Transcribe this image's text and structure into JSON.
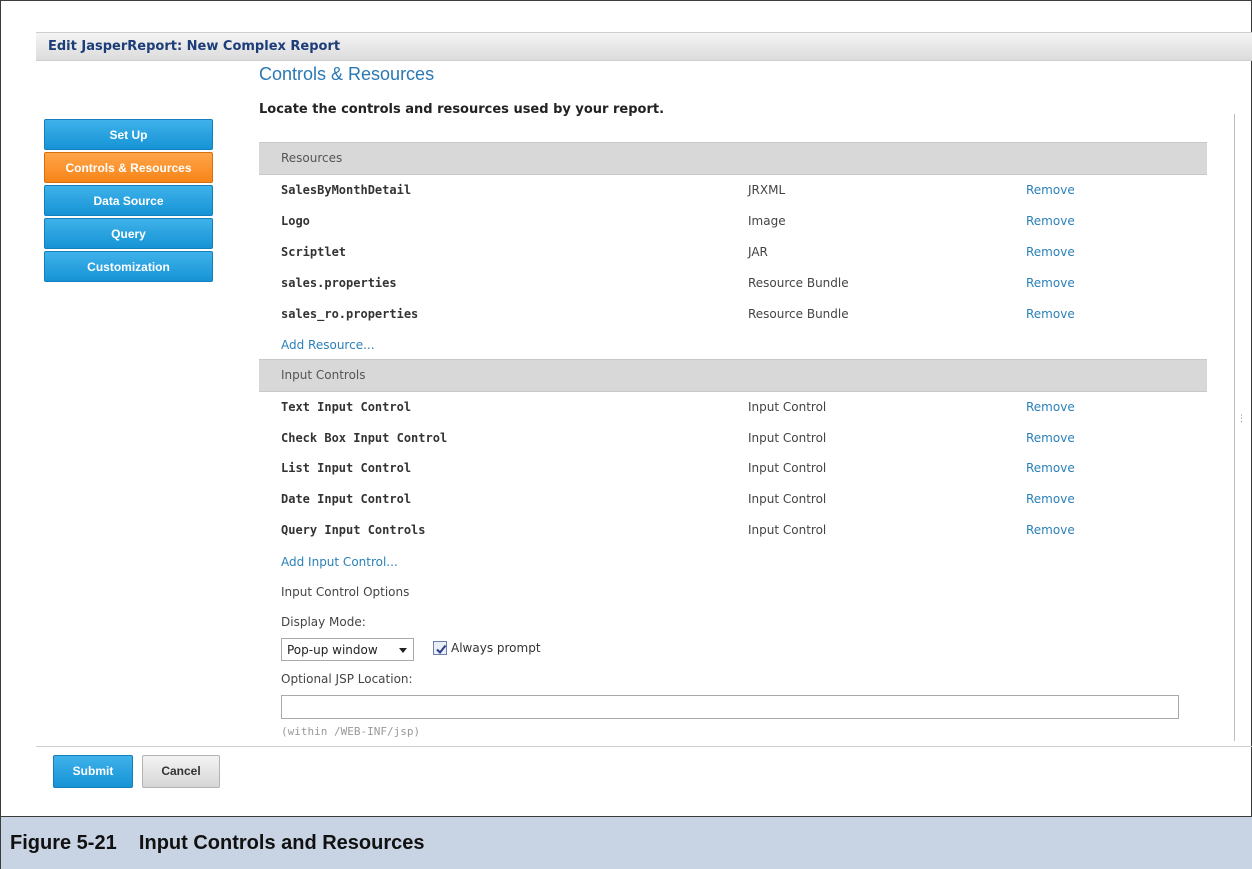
{
  "window": {
    "title": "Edit JasperReport: New Complex Report"
  },
  "nav": {
    "items": [
      {
        "label": "Set Up"
      },
      {
        "label": "Controls & Resources"
      },
      {
        "label": "Data Source"
      },
      {
        "label": "Query"
      },
      {
        "label": "Customization"
      }
    ],
    "active_index": 1
  },
  "main": {
    "heading": "Controls & Resources",
    "subtitle": "Locate the controls and resources used by your report.",
    "resources": {
      "section_label": "Resources",
      "rows": [
        {
          "name": "SalesByMonthDetail",
          "type": "JRXML",
          "action": "Remove"
        },
        {
          "name": "Logo",
          "type": "Image",
          "action": "Remove"
        },
        {
          "name": "Scriptlet",
          "type": "JAR",
          "action": "Remove"
        },
        {
          "name": "sales.properties",
          "type": "Resource Bundle",
          "action": "Remove"
        },
        {
          "name": "sales_ro.properties",
          "type": "Resource Bundle",
          "action": "Remove"
        }
      ],
      "add_link": "Add Resource..."
    },
    "input_controls": {
      "section_label": "Input Controls",
      "rows": [
        {
          "name": "Text Input Control",
          "type": "Input Control",
          "action": "Remove"
        },
        {
          "name": "Check Box Input Control",
          "type": "Input Control",
          "action": "Remove"
        },
        {
          "name": "List Input Control",
          "type": "Input Control",
          "action": "Remove"
        },
        {
          "name": "Date Input Control",
          "type": "Input Control",
          "action": "Remove"
        },
        {
          "name": "Query Input Controls",
          "type": "Input Control",
          "action": "Remove"
        }
      ],
      "add_link": "Add Input Control..."
    },
    "options": {
      "title": "Input Control Options",
      "display_mode_label": "Display Mode:",
      "display_mode_value": "Pop-up window",
      "always_prompt_label": "Always prompt",
      "always_prompt_checked": true,
      "jsp_label": "Optional JSP Location:",
      "jsp_value": "",
      "jsp_hint": "(within /WEB-INF/jsp)"
    }
  },
  "footer": {
    "submit_label": "Submit",
    "cancel_label": "Cancel"
  },
  "caption": {
    "text": "Figure 5-21    Input Controls and Resources"
  },
  "colors": {
    "nav_blue": "#1a9ad9",
    "nav_active_orange": "#f7871a",
    "link_blue": "#2a80b9",
    "heading_blue": "#2a78b2"
  },
  "icons": {
    "select_caret": "chevron-down-icon",
    "checkbox": "checkmark-icon"
  }
}
